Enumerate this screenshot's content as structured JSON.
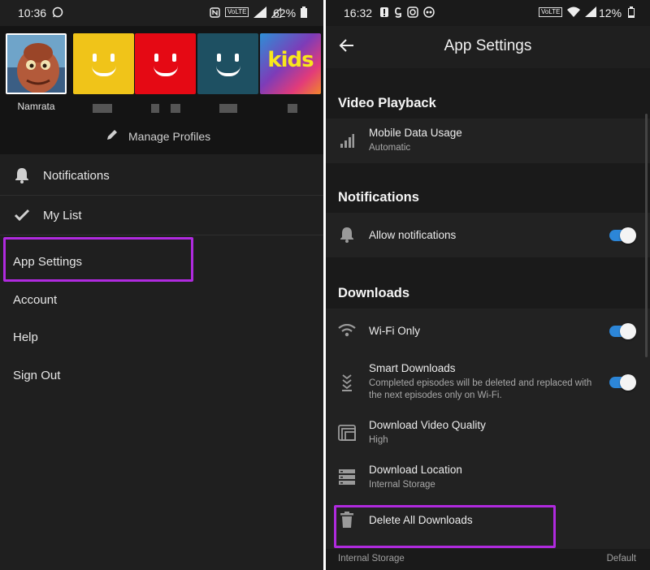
{
  "left": {
    "status": {
      "time": "10:36",
      "battery": "62%",
      "volte": "VoLTE",
      "network": "4G"
    },
    "profiles": [
      {
        "name": "Namrata",
        "kind": "character",
        "selected": true
      },
      {
        "name": "",
        "kind": "smiley",
        "color": "#f0c419"
      },
      {
        "name": "",
        "kind": "smiley",
        "color": "#e50914"
      },
      {
        "name": "",
        "kind": "smiley",
        "color": "#1e5062"
      },
      {
        "name": "",
        "kind": "kids",
        "label": "kids"
      }
    ],
    "manage_profiles": "Manage Profiles",
    "menu": [
      {
        "label": "Notifications",
        "icon": "bell-icon"
      },
      {
        "label": "My List",
        "icon": "check-icon"
      }
    ],
    "links": [
      "App Settings",
      "Account",
      "Help",
      "Sign Out"
    ],
    "highlight_color": "#b02adf"
  },
  "right": {
    "status": {
      "time": "16:32",
      "battery": "12%",
      "volte": "VoLTE"
    },
    "title": "App Settings",
    "sections": {
      "video": {
        "title": "Video Playback",
        "mobile_data": {
          "title": "Mobile Data Usage",
          "sub": "Automatic",
          "icon": "signal-icon"
        }
      },
      "notifications": {
        "title": "Notifications",
        "allow": {
          "title": "Allow notifications",
          "icon": "bell-icon",
          "on": true
        }
      },
      "downloads": {
        "title": "Downloads",
        "wifi": {
          "title": "Wi-Fi Only",
          "icon": "wifi-icon",
          "on": true
        },
        "smart": {
          "title": "Smart Downloads",
          "sub": "Completed episodes will be deleted and replaced with the next episodes only on Wi-Fi.",
          "icon": "smart-downloads-icon",
          "on": true
        },
        "quality": {
          "title": "Download Video Quality",
          "sub": "High",
          "icon": "video-quality-icon"
        },
        "location": {
          "title": "Download Location",
          "sub": "Internal Storage",
          "icon": "storage-icon"
        },
        "delete": {
          "title": "Delete All Downloads",
          "icon": "trash-icon"
        }
      }
    },
    "footer": {
      "left": "Internal Storage",
      "right": "Default"
    },
    "accent": "#2c86d8",
    "highlight_color": "#b02adf"
  }
}
